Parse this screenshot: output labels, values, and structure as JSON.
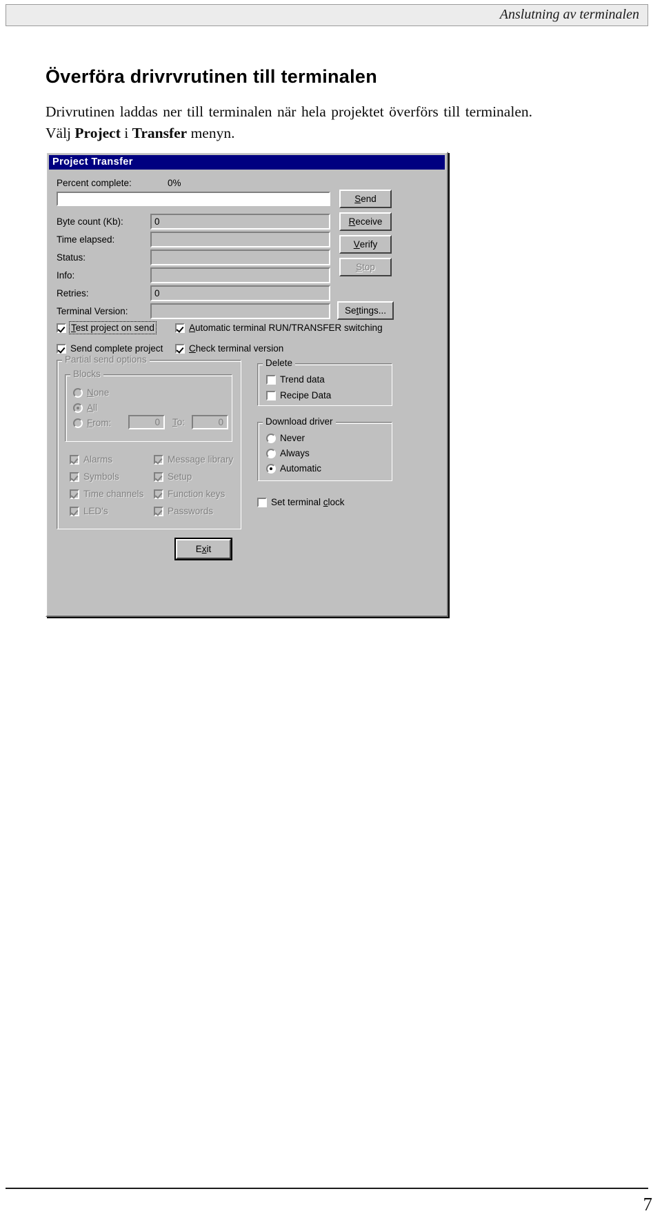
{
  "page": {
    "header_title": "Anslutning av terminalen",
    "page_number": "7",
    "heading": "Överföra drivrvrutinen till terminalen",
    "body_part1": "Drivrutinen laddas ner till terminalen när hela projektet överförs till terminalen. Välj ",
    "body_bold1": "Project",
    "body_part2": " i ",
    "body_bold2": "Transfer",
    "body_part3": " menyn."
  },
  "dialog": {
    "title": "Project Transfer",
    "fields": {
      "percent_complete_label": "Percent complete:",
      "percent_complete_value": "0%",
      "progress_percent": 0,
      "byte_count_label": "Byte count (Kb):",
      "byte_count_value": "0",
      "time_elapsed_label": "Time elapsed:",
      "time_elapsed_value": "",
      "status_label": "Status:",
      "status_value": "",
      "info_label": "Info:",
      "info_value": "",
      "retries_label": "Retries:",
      "retries_value": "0",
      "terminal_version_label": "Terminal Version:",
      "terminal_version_value": ""
    },
    "buttons": {
      "send": {
        "pre": "",
        "acc": "S",
        "post": "end"
      },
      "receive": {
        "pre": "",
        "acc": "R",
        "post": "eceive"
      },
      "verify": {
        "pre": "",
        "acc": "V",
        "post": "erify"
      },
      "stop": {
        "pre": "",
        "acc": "S",
        "post": "top"
      },
      "settings": {
        "pre": "Se",
        "acc": "t",
        "post": "tings..."
      },
      "exit": {
        "pre": "E",
        "acc": "x",
        "post": "it"
      }
    },
    "top_checkboxes": [
      {
        "pre": "",
        "acc": "T",
        "post": "est project on send",
        "checked": true,
        "enabled": true,
        "focused": true
      },
      {
        "pre": "",
        "acc": "A",
        "post": "utomatic terminal RUN/TRANSFER switching",
        "checked": true,
        "enabled": true,
        "focused": false
      },
      {
        "pre": "Send complete project",
        "acc": "",
        "post": "",
        "checked": true,
        "enabled": true,
        "focused": false
      },
      {
        "pre": "",
        "acc": "C",
        "post": "heck terminal version",
        "checked": true,
        "enabled": true,
        "focused": false
      }
    ],
    "partial_send": {
      "group_title": "Partial send options",
      "enabled": false,
      "blocks": {
        "group_title": "Blocks",
        "options": [
          {
            "pre": "",
            "acc": "N",
            "post": "one",
            "selected": false
          },
          {
            "pre": "",
            "acc": "A",
            "post": "ll",
            "selected": true
          },
          {
            "pre": "",
            "acc": "F",
            "post": "rom:",
            "selected": false
          }
        ],
        "from_value": "0",
        "to_label_pre": "",
        "to_label_acc": "T",
        "to_label_post": "o:",
        "to_value": "0"
      },
      "checkboxes": [
        {
          "label": "Alarms",
          "checked": true
        },
        {
          "label": "Message library",
          "checked": true
        },
        {
          "label": "Symbols",
          "checked": true
        },
        {
          "label": "Setup",
          "checked": true
        },
        {
          "label": "Time channels",
          "checked": true
        },
        {
          "label": "Function keys",
          "checked": true
        },
        {
          "label": "LED's",
          "checked": true
        },
        {
          "label": "Passwords",
          "checked": true
        }
      ]
    },
    "delete_group": {
      "group_title": "Delete",
      "checkboxes": [
        {
          "label": "Trend data",
          "checked": false
        },
        {
          "label": "Recipe Data",
          "checked": false
        }
      ]
    },
    "download_driver": {
      "group_title": "Download driver",
      "options": [
        {
          "label": "Never",
          "selected": false
        },
        {
          "label": "Always",
          "selected": false
        },
        {
          "label": "Automatic",
          "selected": true
        }
      ]
    },
    "set_terminal_clock": {
      "pre": "Set terminal ",
      "acc": "c",
      "post": "lock",
      "checked": false
    }
  },
  "colors": {
    "titlebar": "#000080",
    "dialog_face": "#c0c0c0",
    "header_band": "#ececec",
    "disabled_text": "#808080"
  }
}
